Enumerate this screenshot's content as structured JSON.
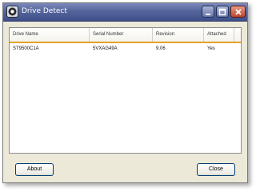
{
  "window": {
    "title": "Drive Detect"
  },
  "titlebar_buttons": {
    "minimize": "minimize",
    "maximize": "maximize",
    "close": "close"
  },
  "list": {
    "columns": [
      "Drive Name",
      "Serial Number",
      "Revision",
      "Attached"
    ],
    "rows": [
      [
        "ST9500C1A",
        "5VXAG49A",
        "9.06",
        "Yes"
      ]
    ]
  },
  "buttons": {
    "about": "About",
    "close": "Close"
  },
  "colors": {
    "titlebar": "#55659c",
    "header_underline": "#e4a224",
    "close_button": "#c1452d",
    "dialog_face": "#ece9d8"
  }
}
